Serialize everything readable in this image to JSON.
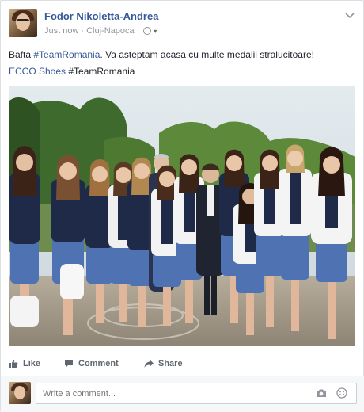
{
  "post": {
    "author": "Fodor Nikoletta-Andrea",
    "time": "Just now",
    "separator": "·",
    "location": "Cluj-Napoca",
    "separator2": "·",
    "caret": "▾",
    "text_prefix": "Bafta ",
    "hashtag1": "#TeamRomania",
    "text_body": ". Va asteptam acasa cu multe medalii stralucitoare!",
    "line2_link": "ECCO Shoes",
    "line2_tag": " #TeamRomania"
  },
  "actions": {
    "like": "Like",
    "comment": "Comment",
    "share": "Share"
  },
  "comment_box": {
    "placeholder": "Write a comment..."
  },
  "colors": {
    "link": "#365899",
    "muted": "#90949c",
    "blazer": "#1f2a48",
    "skirt": "#4f72b3"
  },
  "icons": [
    "chevron-down-icon",
    "globe-icon",
    "like-icon",
    "comment-icon",
    "share-icon",
    "camera-icon",
    "emoji-icon"
  ]
}
